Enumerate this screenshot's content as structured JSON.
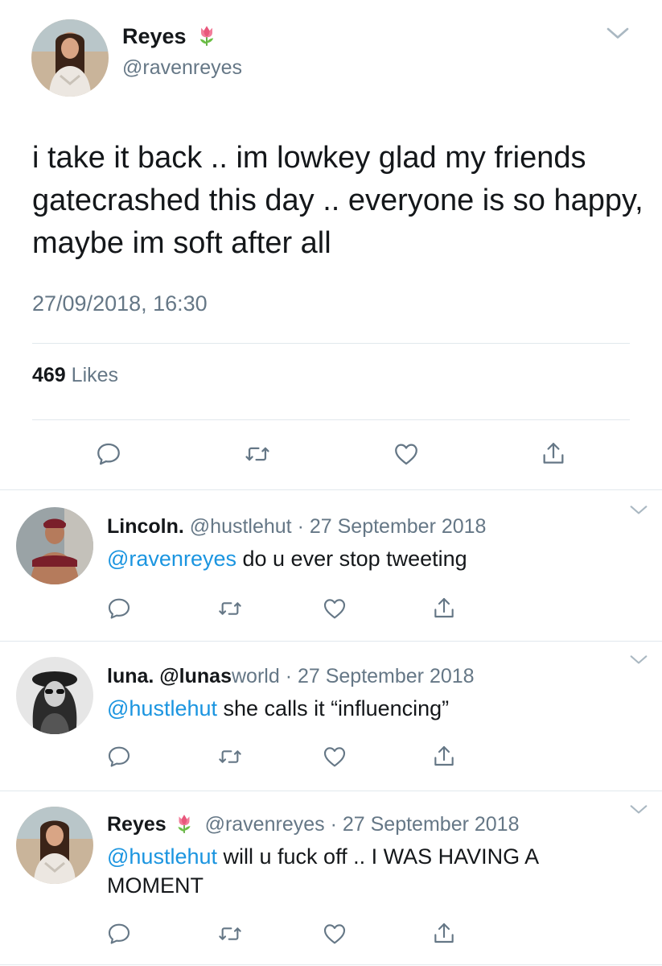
{
  "main_tweet": {
    "display_name": "Reyes",
    "name_emoji": "tulip",
    "handle": "@ravenreyes",
    "text": "i take it back .. im lowkey glad my friends gatecrashed this day .. everyone is so happy, maybe im soft after all",
    "timestamp": "27/09/2018, 16:30",
    "likes_count": "469",
    "likes_label": "Likes"
  },
  "replies": [
    {
      "display_name": "Lincoln.",
      "handle": "@hustlehut",
      "separator": "·",
      "date": "27 September 2018",
      "mention": "@ravenreyes",
      "text": "do u ever stop tweeting"
    },
    {
      "display_name": "luna.",
      "handle_bold": "@lunas",
      "handle_rest": "world",
      "separator": "·",
      "date": "27 September 2018",
      "mention": "@hustlehut",
      "text": "she calls it “influencing”"
    },
    {
      "display_name": "Reyes",
      "name_emoji": "tulip",
      "handle": "@ravenreyes",
      "separator": "·",
      "date": "27 September 2018",
      "mention": "@hustlehut",
      "text": "will u fuck off .. I WAS HAVING A MOMENT"
    }
  ],
  "icons": [
    "chevron-down-icon",
    "reply-icon",
    "retweet-icon",
    "like-heart-icon",
    "share-icon",
    "tulip-emoji-icon"
  ],
  "colors": {
    "text": "#14171a",
    "muted": "#657786",
    "link": "#1b95e0",
    "divider": "#e1e8ed",
    "tulip": "#f27d9a"
  }
}
